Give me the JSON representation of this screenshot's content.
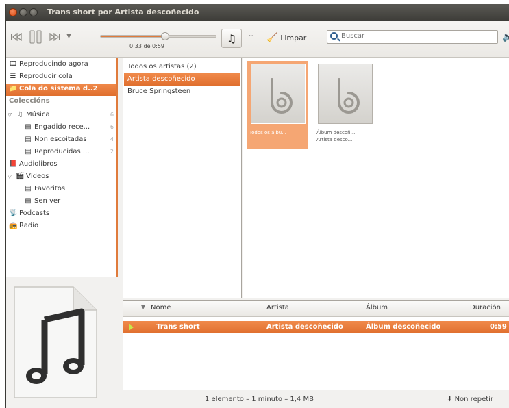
{
  "window": {
    "title": "Trans short por Artista descoñecido"
  },
  "toolbar": {
    "prev_icon": "previous-icon",
    "pause_icon": "pause-icon",
    "next_icon": "next-icon",
    "dropdown_icon": "dropdown-arrow-icon",
    "time": "0:33 de 0:59",
    "progress": 0.56,
    "more_label": "···",
    "clear_label": "Limpar",
    "search_placeholder": "Buscar",
    "accent_color": "#e07b3c"
  },
  "sidebar": {
    "items": [
      {
        "label": "Reproducindo agora",
        "icon": "now-playing-icon"
      },
      {
        "label": "Reproducir cola",
        "icon": "queue-icon"
      },
      {
        "label": "Cola do sistema d..2",
        "icon": "folder-icon",
        "selected": true
      }
    ],
    "collections_header": "Coleccións",
    "collections": [
      {
        "label": "Música",
        "count": "6",
        "icon": "music-note-icon",
        "expandable": true
      },
      {
        "label": "Engadido rece...",
        "count": "6",
        "icon": "playlist-icon",
        "indent": true
      },
      {
        "label": "Non escoitadas",
        "count": "4",
        "icon": "playlist-icon",
        "indent": true
      },
      {
        "label": "Reproducidas ...",
        "count": "2",
        "icon": "playlist-icon",
        "indent": true
      },
      {
        "label": "Audiolibros",
        "count": "",
        "icon": "book-icon"
      },
      {
        "label": "Vídeos",
        "count": "",
        "icon": "film-icon",
        "expandable": true
      },
      {
        "label": "Favoritos",
        "count": "",
        "icon": "playlist-icon",
        "indent": true
      },
      {
        "label": "Sen ver",
        "count": "",
        "icon": "playlist-icon",
        "indent": true
      },
      {
        "label": "Podcasts",
        "count": "",
        "icon": "podcast-icon"
      },
      {
        "label": "Radio",
        "count": "",
        "icon": "radio-icon"
      }
    ]
  },
  "artists": [
    {
      "label": "Todos os artistas (2)"
    },
    {
      "label": "Artista descoñecido",
      "selected": true
    },
    {
      "label": "Bruce Springsteen"
    }
  ],
  "albums": [
    {
      "caption": "Todos os álbu...",
      "caption2": "",
      "selected": true
    },
    {
      "caption": "Álbum descoñ...",
      "caption2": "Artista desco...",
      "selected": false
    }
  ],
  "tracks": {
    "columns": {
      "name": "Nome",
      "artist": "Artista",
      "album": "Álbum",
      "duration": "Duración"
    },
    "rows": [
      {
        "name": "Trans short",
        "artist": "Artista descoñecido",
        "album": "Álbum descoñecido",
        "duration": "0:59",
        "playing": true
      }
    ]
  },
  "status": {
    "summary": "1 elemento – 1 minuto – 1,4 MB",
    "repeat": "Non repetir"
  }
}
